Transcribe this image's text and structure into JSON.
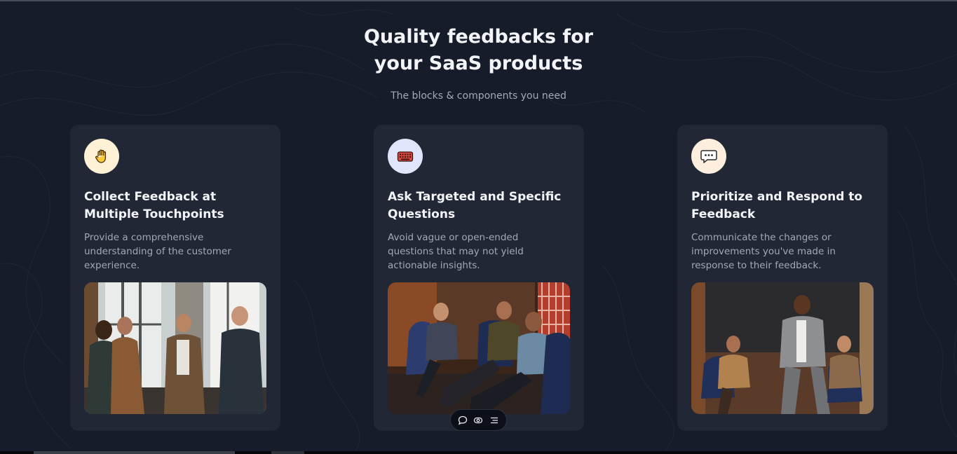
{
  "hero": {
    "title_line1": "Quality feedbacks for",
    "title_line2": "your SaaS products",
    "subtitle": "The blocks & components you need"
  },
  "cards": [
    {
      "icon": "raised-hand-icon",
      "badge_color": "#fff1d6",
      "title": "Collect Feedback at Multiple Touchpoints",
      "description": "Provide a comprehensive understanding of the customer experience."
    },
    {
      "icon": "keyboard-icon",
      "badge_color": "#dfe6fb",
      "title": "Ask Targeted and Specific Questions",
      "description": "Avoid vague or open-ended questions that may not yield actionable insights."
    },
    {
      "icon": "speech-bubble-icon",
      "badge_color": "#fdeede",
      "title": "Prioritize and Respond to Feedback",
      "description": "Communicate the changes or improvements you've made in response to their feedback."
    }
  ],
  "toolbar": {
    "icons": [
      "comment-icon",
      "eye-icon",
      "menu-icon"
    ]
  },
  "colors": {
    "background": "#171c2a",
    "card": "#212735",
    "heading": "#f3f4f7",
    "muted_text": "#a2a8b6"
  }
}
